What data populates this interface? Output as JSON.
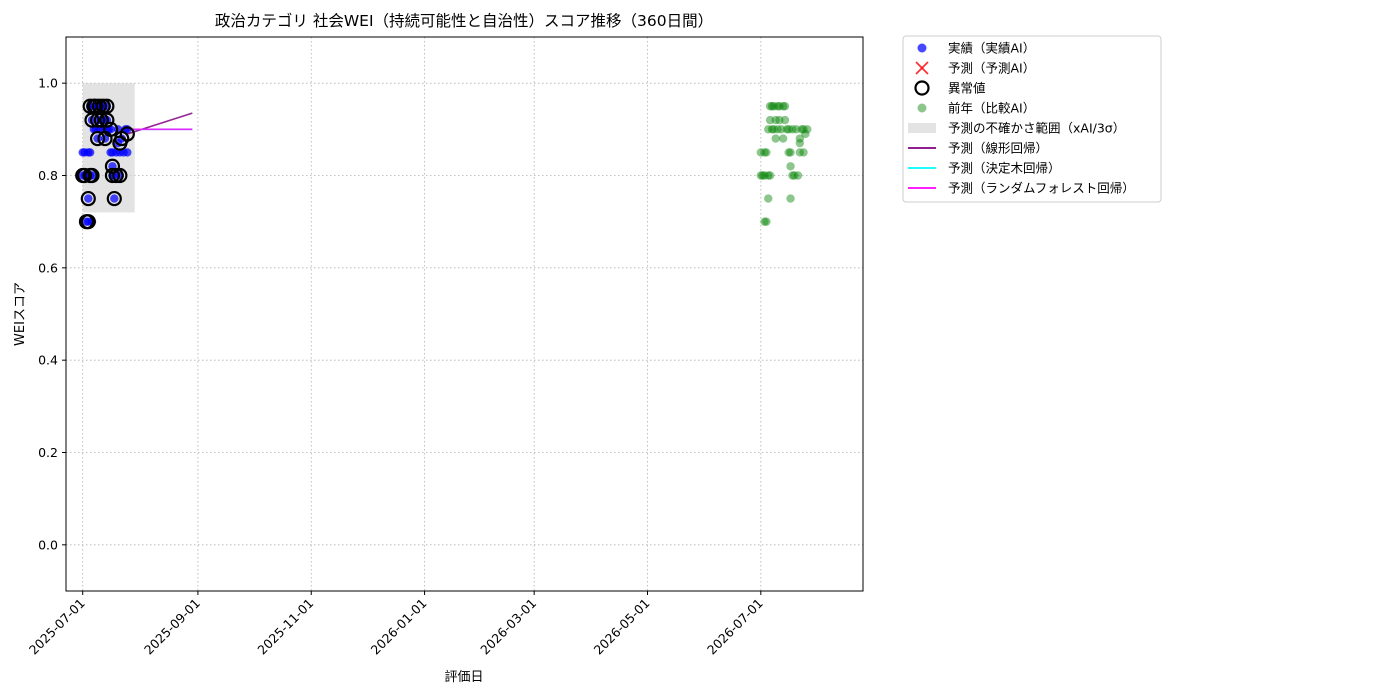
{
  "chart_data": {
    "type": "scatter",
    "title": "政治カテゴリ 社会WEI（持続可能性と自治性）スコア推移（360日間）",
    "xlabel": "評価日",
    "ylabel": "WEIスコア",
    "ylim": [
      -0.1,
      1.1
    ],
    "xlim": [
      "2025-06-22",
      "2026-08-25"
    ],
    "y_ticks": [
      "0.0",
      "0.2",
      "0.4",
      "0.6",
      "0.8",
      "1.0"
    ],
    "x_ticks": [
      "2025-07-01",
      "2025-09-01",
      "2025-11-01",
      "2026-01-01",
      "2026-03-01",
      "2026-05-01",
      "2026-07-01"
    ],
    "grid": true,
    "legend_position": "outside-top-right",
    "colors": {
      "actual": "#0000ff",
      "predicted": "#ff0000",
      "anomaly": "#000000",
      "previous_year": "#008000",
      "band": "#cccccc",
      "linear": "#800080",
      "tree": "#00ffff",
      "forest": "#ff00ff"
    },
    "legend": [
      {
        "key": "actual",
        "label": "実績（実績AI）",
        "kind": "dot"
      },
      {
        "key": "predicted",
        "label": "予測（予測AI）",
        "kind": "x"
      },
      {
        "key": "anomaly",
        "label": "異常値",
        "kind": "ring"
      },
      {
        "key": "previous_year",
        "label": "前年（比較AI）",
        "kind": "dot-light"
      },
      {
        "key": "band",
        "label": "予測の不確かさ範囲（xAI/3σ）",
        "kind": "band"
      },
      {
        "key": "linear",
        "label": "予測（線形回帰）",
        "kind": "line"
      },
      {
        "key": "tree",
        "label": "予測（決定木回帰）",
        "kind": "line"
      },
      {
        "key": "forest",
        "label": "予測（ランダムフォレスト回帰）",
        "kind": "line"
      }
    ],
    "series": [
      {
        "key": "actual",
        "points": [
          [
            "2025-07-01",
            0.8
          ],
          [
            "2025-07-01",
            0.85
          ],
          [
            "2025-07-02",
            0.8
          ],
          [
            "2025-07-02",
            0.85
          ],
          [
            "2025-07-03",
            0.8
          ],
          [
            "2025-07-03",
            0.7
          ],
          [
            "2025-07-04",
            0.85
          ],
          [
            "2025-07-04",
            0.7
          ],
          [
            "2025-07-04",
            0.75
          ],
          [
            "2025-07-05",
            0.8
          ],
          [
            "2025-07-05",
            0.95
          ],
          [
            "2025-07-05",
            0.85
          ],
          [
            "2025-07-06",
            0.92
          ],
          [
            "2025-07-06",
            0.8
          ],
          [
            "2025-07-06",
            0.7
          ],
          [
            "2025-07-07",
            0.95
          ],
          [
            "2025-07-07",
            0.9
          ],
          [
            "2025-07-08",
            0.95
          ],
          [
            "2025-07-08",
            0.9
          ],
          [
            "2025-07-09",
            0.88
          ],
          [
            "2025-07-09",
            0.92
          ],
          [
            "2025-07-09",
            0.95
          ],
          [
            "2025-07-10",
            0.9
          ],
          [
            "2025-07-10",
            0.95
          ],
          [
            "2025-07-11",
            0.92
          ],
          [
            "2025-07-11",
            0.95
          ],
          [
            "2025-07-12",
            0.9
          ],
          [
            "2025-07-12",
            0.95
          ],
          [
            "2025-07-13",
            0.88
          ],
          [
            "2025-07-13",
            0.92
          ],
          [
            "2025-07-14",
            0.95
          ],
          [
            "2025-07-14",
            0.92
          ],
          [
            "2025-07-14",
            0.9
          ],
          [
            "2025-07-15",
            0.9
          ],
          [
            "2025-07-16",
            0.9
          ],
          [
            "2025-07-16",
            0.85
          ],
          [
            "2025-07-17",
            0.8
          ],
          [
            "2025-07-17",
            0.82
          ],
          [
            "2025-07-17",
            0.85
          ],
          [
            "2025-07-18",
            0.75
          ],
          [
            "2025-07-18",
            0.8
          ],
          [
            "2025-07-19",
            0.85
          ],
          [
            "2025-07-20",
            0.9
          ],
          [
            "2025-07-20",
            0.87
          ],
          [
            "2025-07-21",
            0.8
          ],
          [
            "2025-07-21",
            0.85
          ],
          [
            "2025-07-22",
            0.88
          ],
          [
            "2025-07-23",
            0.85
          ],
          [
            "2025-07-24",
            0.9
          ],
          [
            "2025-07-25",
            0.9
          ],
          [
            "2025-07-25",
            0.85
          ]
        ]
      },
      {
        "key": "anomaly",
        "points": [
          [
            "2025-07-01",
            0.8
          ],
          [
            "2025-07-02",
            0.8
          ],
          [
            "2025-07-03",
            0.7
          ],
          [
            "2025-07-04",
            0.7
          ],
          [
            "2025-07-04",
            0.75
          ],
          [
            "2025-07-05",
            0.8
          ],
          [
            "2025-07-05",
            0.95
          ],
          [
            "2025-07-06",
            0.92
          ],
          [
            "2025-07-06",
            0.8
          ],
          [
            "2025-07-07",
            0.95
          ],
          [
            "2025-07-08",
            0.95
          ],
          [
            "2025-07-09",
            0.88
          ],
          [
            "2025-07-09",
            0.92
          ],
          [
            "2025-07-10",
            0.95
          ],
          [
            "2025-07-11",
            0.92
          ],
          [
            "2025-07-12",
            0.95
          ],
          [
            "2025-07-13",
            0.88
          ],
          [
            "2025-07-14",
            0.95
          ],
          [
            "2025-07-14",
            0.92
          ],
          [
            "2025-07-16",
            0.9
          ],
          [
            "2025-07-17",
            0.8
          ],
          [
            "2025-07-17",
            0.82
          ],
          [
            "2025-07-18",
            0.75
          ],
          [
            "2025-07-19",
            0.8
          ],
          [
            "2025-07-21",
            0.8
          ],
          [
            "2025-07-21",
            0.87
          ],
          [
            "2025-07-22",
            0.88
          ],
          [
            "2025-07-25",
            0.89
          ]
        ]
      },
      {
        "key": "previous_year",
        "points": [
          [
            "2026-07-01",
            0.85
          ],
          [
            "2026-07-01",
            0.8
          ],
          [
            "2026-07-02",
            0.8
          ],
          [
            "2026-07-03",
            0.85
          ],
          [
            "2026-07-03",
            0.7
          ],
          [
            "2026-07-03",
            0.8
          ],
          [
            "2026-07-04",
            0.85
          ],
          [
            "2026-07-04",
            0.7
          ],
          [
            "2026-07-05",
            0.8
          ],
          [
            "2026-07-05",
            0.75
          ],
          [
            "2026-07-05",
            0.9
          ],
          [
            "2026-07-06",
            0.95
          ],
          [
            "2026-07-06",
            0.92
          ],
          [
            "2026-07-06",
            0.8
          ],
          [
            "2026-07-07",
            0.9
          ],
          [
            "2026-07-07",
            0.95
          ],
          [
            "2026-07-08",
            0.95
          ],
          [
            "2026-07-08",
            0.9
          ],
          [
            "2026-07-09",
            0.88
          ],
          [
            "2026-07-09",
            0.92
          ],
          [
            "2026-07-10",
            0.95
          ],
          [
            "2026-07-10",
            0.9
          ],
          [
            "2026-07-11",
            0.95
          ],
          [
            "2026-07-11",
            0.92
          ],
          [
            "2026-07-12",
            0.9
          ],
          [
            "2026-07-13",
            0.95
          ],
          [
            "2026-07-13",
            0.88
          ],
          [
            "2026-07-14",
            0.92
          ],
          [
            "2026-07-14",
            0.95
          ],
          [
            "2026-07-15",
            0.9
          ],
          [
            "2026-07-16",
            0.9
          ],
          [
            "2026-07-16",
            0.85
          ],
          [
            "2026-07-17",
            0.82
          ],
          [
            "2026-07-17",
            0.85
          ],
          [
            "2026-07-17",
            0.75
          ],
          [
            "2026-07-18",
            0.8
          ],
          [
            "2026-07-18",
            0.9
          ],
          [
            "2026-07-19",
            0.8
          ],
          [
            "2026-07-20",
            0.9
          ],
          [
            "2026-07-21",
            0.8
          ],
          [
            "2026-07-22",
            0.85
          ],
          [
            "2026-07-22",
            0.87
          ],
          [
            "2026-07-22",
            0.88
          ],
          [
            "2026-07-23",
            0.9
          ],
          [
            "2026-07-24",
            0.85
          ],
          [
            "2026-07-24",
            0.9
          ],
          [
            "2026-07-25",
            0.89
          ],
          [
            "2026-07-26",
            0.9
          ]
        ]
      }
    ],
    "uncertainty_band": {
      "x": [
        "2025-07-01",
        "2025-07-29"
      ],
      "y": [
        0.72,
        1.0
      ]
    },
    "lines": [
      {
        "key": "linear",
        "points": [
          [
            "2025-07-25",
            0.89
          ],
          [
            "2025-08-29",
            0.935
          ]
        ]
      },
      {
        "key": "tree",
        "points": [
          [
            "2025-07-25",
            0.9
          ],
          [
            "2025-08-29",
            0.9
          ]
        ]
      },
      {
        "key": "forest",
        "points": [
          [
            "2025-07-25",
            0.9
          ],
          [
            "2025-08-29",
            0.9
          ]
        ]
      }
    ]
  }
}
